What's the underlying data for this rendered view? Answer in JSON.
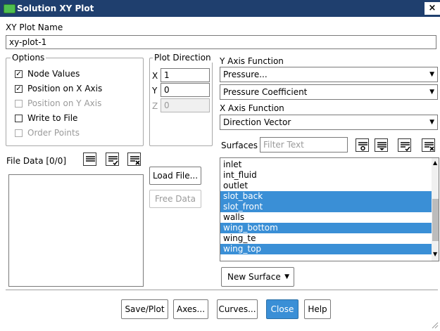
{
  "window": {
    "title": "Solution XY Plot",
    "close_label": "×"
  },
  "plot_name": {
    "label": "XY Plot Name",
    "value": "xy-plot-1"
  },
  "options": {
    "label": "Options",
    "items": [
      {
        "label": "Node Values",
        "checked": true,
        "enabled": true
      },
      {
        "label": "Position on X Axis",
        "checked": true,
        "enabled": true
      },
      {
        "label": "Position on Y Axis",
        "checked": false,
        "enabled": false
      },
      {
        "label": "Write to File",
        "checked": false,
        "enabled": true
      },
      {
        "label": "Order Points",
        "checked": false,
        "enabled": false
      }
    ]
  },
  "plot_direction": {
    "label": "Plot Direction",
    "x_label": "X",
    "x_value": "1",
    "y_label": "Y",
    "y_value": "0",
    "z_label": "Z",
    "z_value": "0"
  },
  "y_axis": {
    "label": "Y Axis Function",
    "value1": "Pressure...",
    "value2": "Pressure Coefficient"
  },
  "x_axis": {
    "label": "X Axis Function",
    "value": "Direction Vector"
  },
  "surfaces": {
    "label": "Surfaces",
    "filter_placeholder": "Filter Text",
    "items": [
      {
        "label": "inlet",
        "selected": false
      },
      {
        "label": "int_fluid",
        "selected": false
      },
      {
        "label": "outlet",
        "selected": false
      },
      {
        "label": "slot_back",
        "selected": true
      },
      {
        "label": "slot_front",
        "selected": true
      },
      {
        "label": "walls",
        "selected": false
      },
      {
        "label": "wing_bottom",
        "selected": true
      },
      {
        "label": "wing_te",
        "selected": false
      },
      {
        "label": "wing_top",
        "selected": true
      }
    ],
    "new_surface_label": "New Surface"
  },
  "file_data": {
    "label": "File Data [0/0]",
    "load_label": "Load File...",
    "free_label": "Free Data"
  },
  "actions": {
    "save": "Save/Plot",
    "axes": "Axes...",
    "curves": "Curves...",
    "close": "Close",
    "help": "Help"
  },
  "colors": {
    "titlebar": "#1f3f6e",
    "selection": "#3a8fd6"
  }
}
